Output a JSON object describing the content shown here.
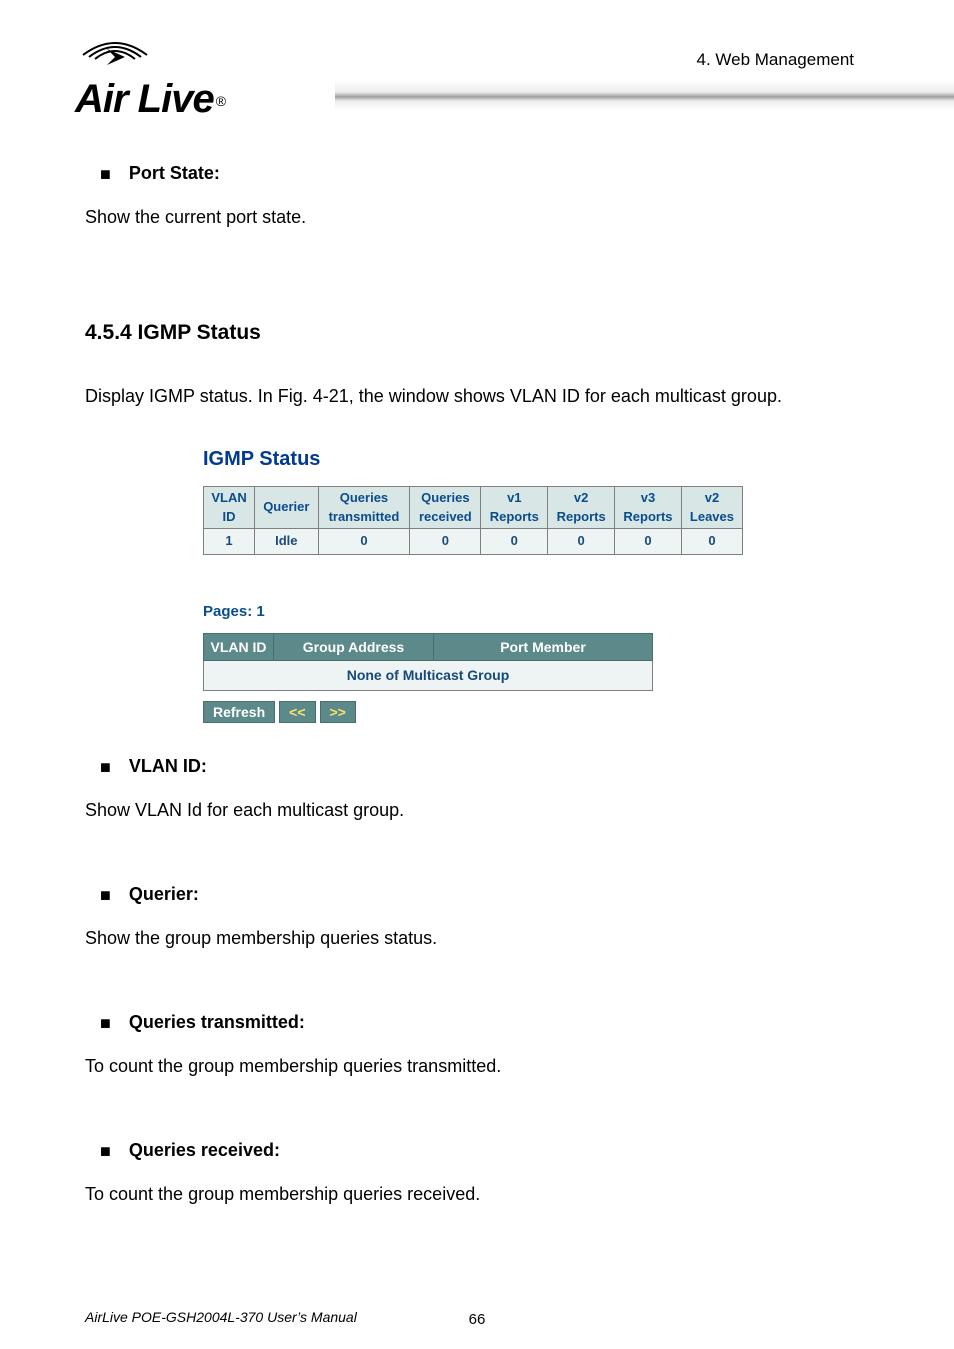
{
  "header": {
    "brand": "AirLive",
    "chapter_label": "4.  Web  Management"
  },
  "body": {
    "port_state": {
      "heading": "Port State:",
      "desc": "Show the current port state."
    },
    "section": {
      "number_title": "4.5.4 IGMP Status",
      "desc": "Display IGMP status. In Fig. 4-21, the window shows VLAN ID for each multicast group."
    },
    "shot": {
      "title": "IGMP Status",
      "headers": {
        "c0a": "VLAN",
        "c0b": "ID",
        "c1": "Querier",
        "c2a": "Queries",
        "c2b": "transmitted",
        "c3a": "Queries",
        "c3b": "received",
        "c4a": "v1",
        "c4b": "Reports",
        "c5a": "v2",
        "c5b": "Reports",
        "c6a": "v3",
        "c6b": "Reports",
        "c7a": "v2",
        "c7b": "Leaves"
      },
      "row": {
        "c0": "1",
        "c1": "Idle",
        "c2": "0",
        "c3": "0",
        "c4": "0",
        "c5": "0",
        "c6": "0",
        "c7": "0"
      },
      "pages_label": "Pages: 1",
      "group_headers": {
        "h1": "VLAN ID",
        "h2": "Group Address",
        "h3": "Port Member"
      },
      "group_none": "None of Multicast Group",
      "buttons": {
        "refresh": "Refresh",
        "prev": "<<",
        "next": ">>"
      }
    },
    "bullets": {
      "vlan_id": {
        "heading": "VLAN ID:",
        "desc": "Show VLAN Id for each multicast group."
      },
      "querier": {
        "heading": "Querier:",
        "desc": "Show the group membership queries status."
      },
      "q_trans": {
        "heading": "Queries transmitted:",
        "desc": "To count the group membership queries transmitted."
      },
      "q_recv": {
        "heading": "Queries received:",
        "desc": "To count the group membership queries received."
      }
    }
  },
  "footer": {
    "manual": "AirLive POE-GSH2004L-370 User’s Manual",
    "page": "66"
  }
}
